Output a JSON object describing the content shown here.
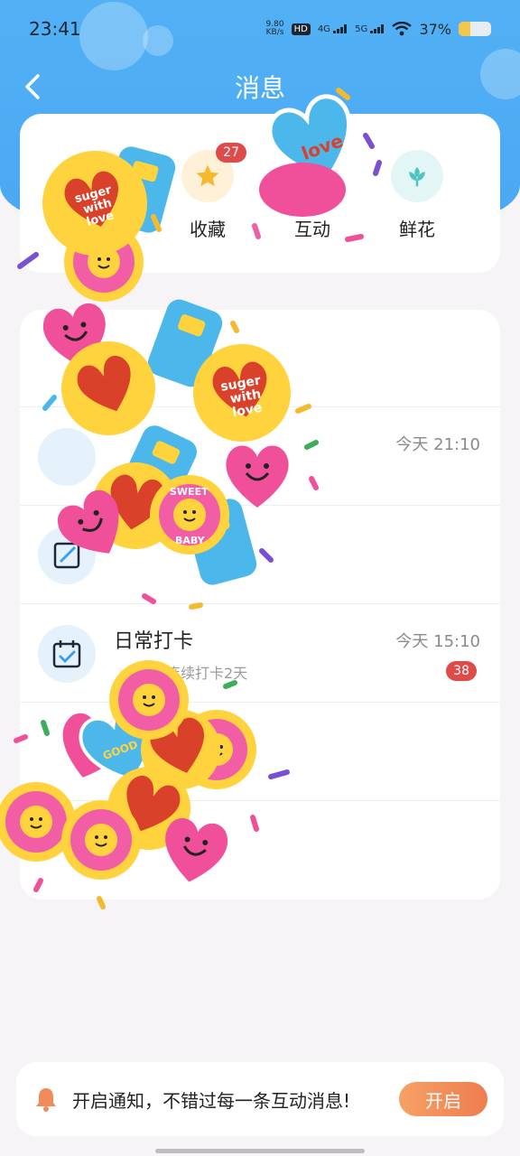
{
  "status_bar": {
    "time": "23:41",
    "net_speed_value": "9.80",
    "net_speed_unit": "KB/s",
    "hd_label": "HD",
    "net_4g": "4G",
    "net_5g": "5G",
    "battery_percent_text": "37%",
    "battery_level": 0.37
  },
  "nav": {
    "title": "消息",
    "back_icon": "chevron-left-icon"
  },
  "quick_actions": [
    {
      "label": "",
      "icon": "bell-icon",
      "badge": ""
    },
    {
      "label": "收藏",
      "icon": "star-icon",
      "badge": "27"
    },
    {
      "label": "互动",
      "icon": "comment-icon",
      "badge": ""
    },
    {
      "label": "鲜花",
      "icon": "flower-icon",
      "badge": ""
    }
  ],
  "messages": [
    {
      "title": "",
      "time": "",
      "subtitle": "",
      "badge": ""
    },
    {
      "title": "",
      "time": "今天 21:10",
      "subtitle": "",
      "badge": ""
    },
    {
      "title": "",
      "time": "",
      "subtitle": "",
      "badge": ""
    },
    {
      "title": "日常打卡",
      "time": "今天 15:10",
      "subtitle": "连续打卡2天",
      "badge": "38"
    },
    {
      "title": "",
      "time": "",
      "subtitle": "",
      "badge": ""
    },
    {
      "title": "",
      "time": "",
      "subtitle": "",
      "badge": ""
    }
  ],
  "notify": {
    "text": "开启通知，不错过每一条互动消息!",
    "button": "开启"
  },
  "stickers": {
    "suger_line1": "suger",
    "suger_line2": "with",
    "suger_line3": "love",
    "love": "love",
    "good": "GOOD",
    "sweet": "SWEET",
    "baby": "BABY"
  },
  "colors": {
    "header_blue": "#4aa8f2",
    "badge_red": "#dd4b4b",
    "button_orange": "#ee7c4f"
  }
}
